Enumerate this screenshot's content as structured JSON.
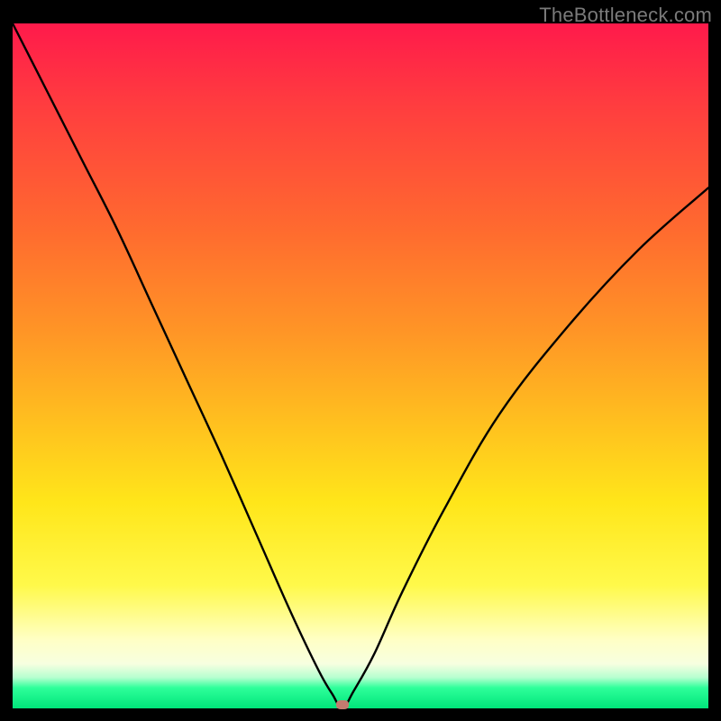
{
  "watermark": "TheBottleneck.com",
  "chart_data": {
    "type": "line",
    "title": "",
    "xlabel": "",
    "ylabel": "",
    "xlim": [
      0,
      100
    ],
    "ylim": [
      0,
      100
    ],
    "grid": false,
    "series": [
      {
        "name": "bottleneck-curve",
        "x": [
          0,
          5,
          10,
          15,
          20,
          25,
          30,
          35,
          40,
          44,
          46,
          47.4,
          49,
          52,
          56,
          62,
          70,
          80,
          90,
          100
        ],
        "values": [
          100,
          90,
          80,
          70,
          59,
          48,
          37,
          25.5,
          14,
          5.5,
          2,
          0,
          2.5,
          8,
          17,
          29,
          43,
          56,
          67,
          76
        ]
      }
    ],
    "annotations": [
      {
        "name": "minimum-marker",
        "x": 47.4,
        "y": 0.5
      }
    ],
    "background_gradient": {
      "top": "#ff1a4b",
      "bottom": "#00e57a"
    }
  }
}
